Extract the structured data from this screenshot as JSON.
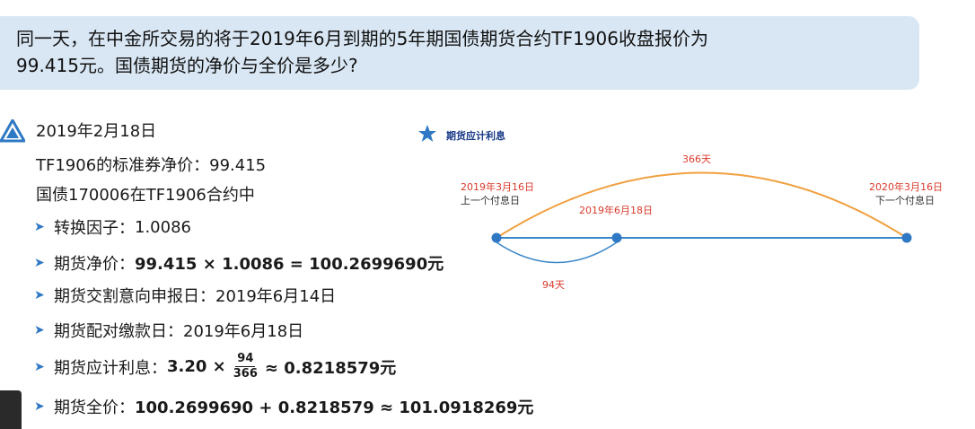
{
  "question": {
    "line1": "同一天，在中金所交易的将于2019年6月到期的5年期国债期货合约TF1906收盘报价为",
    "line2": "99.415元。国债期货的净价与全价是多少?"
  },
  "content": {
    "date": "2019年2月18日",
    "clean_price_line": "TF1906的标准券净价：99.415",
    "bond_line": "国债170006在TF1906合约中",
    "bullets": [
      {
        "label": "转换因子：",
        "value": "1.0086"
      },
      {
        "label": "期货净价：",
        "value": "99.415 × 1.0086 = 100.2699690元"
      },
      {
        "label": "期货交割意向申报日：",
        "value": "2019年6月14日"
      },
      {
        "label": "期货配对缴款日：",
        "value": "2019年6月18日"
      },
      {
        "label": "期货应计利息：",
        "value_prefix": "3.20 ×",
        "frac_num": "94",
        "frac_den": "366",
        "value_suffix": "≈ 0.8218579元"
      },
      {
        "label": "期货全价：",
        "value": "100.2699690 + 0.8218579 ≈ 101.0918269元"
      }
    ]
  },
  "diagram": {
    "legend": "期货应计利息",
    "arc_top_label": "366天",
    "arc_bottom_label": "94天",
    "points": [
      {
        "date": "2019年3月16日",
        "caption": "上一个付息日"
      },
      {
        "date": "2019年6月18日",
        "caption": ""
      },
      {
        "date": "2020年3月16日",
        "caption": "下一个付息日"
      }
    ]
  },
  "colors": {
    "question_bg": "#d9e7f4",
    "accent_blue": "#2f78c4",
    "arc_orange": "#f0a040",
    "date_red": "#d93a2b"
  }
}
